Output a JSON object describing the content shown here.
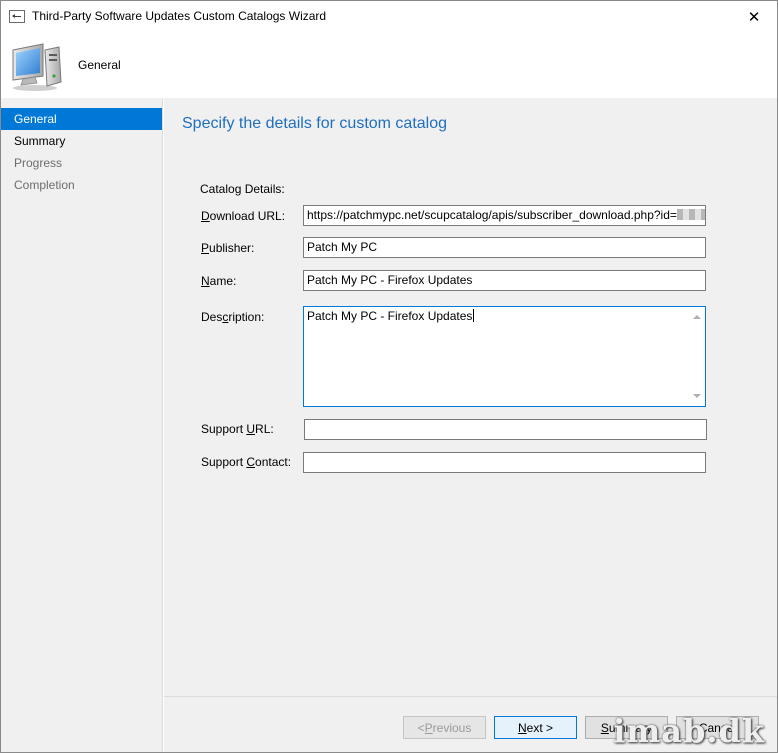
{
  "window": {
    "title": "Third-Party Software Updates Custom Catalogs Wizard",
    "close_glyph": "✕"
  },
  "header": {
    "title": "General",
    "icon": "computer-icon"
  },
  "nav": {
    "items": [
      {
        "label": "General",
        "state": "active"
      },
      {
        "label": "Summary",
        "state": "enabled"
      },
      {
        "label": "Progress",
        "state": "disabled"
      },
      {
        "label": "Completion",
        "state": "disabled"
      }
    ]
  },
  "main": {
    "page_title": "Specify the details for custom catalog",
    "section_label": "Catalog Details:",
    "fields": {
      "download_url": {
        "label_pre": "",
        "label_key": "D",
        "label_post": "ownload URL:",
        "value": "https://patchmypc.net/scupcatalog/apis/subscriber_download.php?id="
      },
      "publisher": {
        "label_pre": "",
        "label_key": "P",
        "label_post": "ublisher:",
        "value": "Patch My PC"
      },
      "name": {
        "label_pre": "",
        "label_key": "N",
        "label_post": "ame:",
        "value": "Patch My PC - Firefox Updates"
      },
      "description": {
        "label_pre": "Des",
        "label_key": "c",
        "label_post": "ription:",
        "value": "Patch My PC - Firefox Updates"
      },
      "support_url": {
        "label_pre": "Support ",
        "label_key": "U",
        "label_post": "RL:",
        "value": ""
      },
      "support_contact": {
        "label_pre": "Support ",
        "label_key": "C",
        "label_post": "ontact:",
        "value": ""
      }
    }
  },
  "footer": {
    "previous": {
      "pre": "< ",
      "key": "P",
      "post": "revious",
      "enabled": false
    },
    "next": {
      "pre": "",
      "key": "N",
      "post": "ext >",
      "enabled": true
    },
    "summary": {
      "pre": "",
      "key": "S",
      "post": "ummary",
      "enabled": true
    },
    "cancel": {
      "label": "Cancel",
      "enabled": true
    }
  },
  "watermark": "imab.dk",
  "colors": {
    "accent": "#0078d7",
    "title_blue": "#1f6fbf",
    "panel_bg": "#f0f0f0"
  }
}
